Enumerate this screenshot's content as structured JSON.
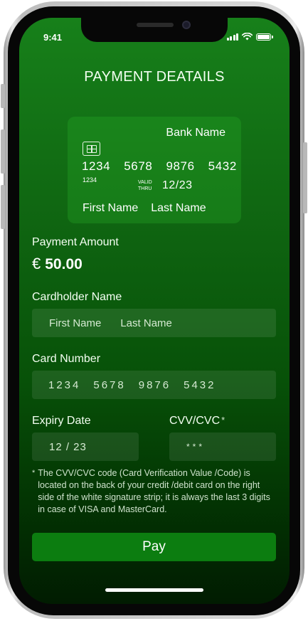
{
  "status_bar": {
    "time": "9:41"
  },
  "header": {
    "title": "PAYMENT DEATAILS"
  },
  "card": {
    "bank_name": "Bank Name",
    "number_groups": [
      "1234",
      "5678",
      "9876",
      "5432"
    ],
    "number_small": "1234",
    "valid_line1": "VALID",
    "valid_line2": "THRU",
    "expiry": "12/23",
    "first_name": "First Name",
    "last_name": "Last Name"
  },
  "payment_amount": {
    "label": "Payment Amount",
    "currency": "€",
    "value": "50.00"
  },
  "cardholder": {
    "label": "Cardholder Name",
    "first_placeholder": "First Name",
    "last_placeholder": "Last Name"
  },
  "card_number": {
    "label": "Card Number",
    "groups": [
      "1234",
      "5678",
      "9876",
      "5432"
    ]
  },
  "expiry": {
    "label": "Expiry Date",
    "value": "12 / 23"
  },
  "cvv": {
    "label": "CVV/CVC",
    "required_mark": "*",
    "placeholder": "***"
  },
  "note": {
    "marker": "*",
    "text": "The CVV/CVC code (Card Verification Value /Code) is located on the back of your credit /debit card on the right side of the white signature strip; it is always the last 3 digits in case of VISA and MasterCard."
  },
  "pay_button": {
    "label": "Pay"
  },
  "colors": {
    "screen_top": "#17801a",
    "screen_bottom": "#011c01",
    "button": "#0c7d10"
  },
  "icons": [
    "signal-icon",
    "wifi-icon",
    "battery-icon",
    "chip-icon"
  ]
}
